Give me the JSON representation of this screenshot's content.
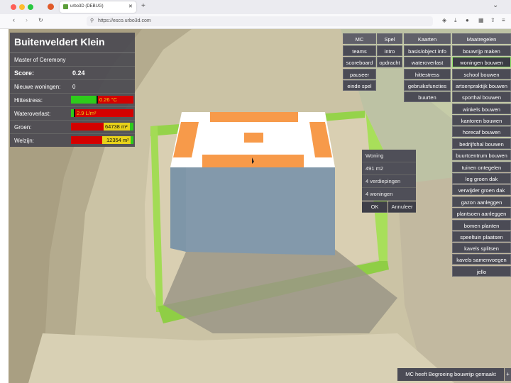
{
  "browser": {
    "tab_title": "urbo3D (DEBUG)",
    "url": "https://esco.urbo3d.com",
    "close_tab": "✕",
    "new_tab": "+",
    "chevron": "⌄"
  },
  "colors": {
    "panel": "#46464e",
    "accent_green": "#8fe36a",
    "bar_red": "#d40000",
    "bar_green": "#2ecc1a",
    "bar_yellow": "#e8d21a"
  },
  "info": {
    "title": "Buitenveldert Klein",
    "role": "Master of Ceremony",
    "score_label": "Score:",
    "score_value": "0.24",
    "homes_label": "Nieuwe woningen:",
    "homes_value": "0",
    "heat_label": "Hittestress:",
    "heat_value": "0.26 °C",
    "water_label": "Wateroverlast:",
    "water_value": "2.9 L/m²",
    "green_label": "Groen:",
    "green_value": "64738 m²",
    "wellbeing_label": "Welzijn:",
    "wellbeing_value": "12354 m²"
  },
  "menu": {
    "mc": {
      "header": "MC",
      "items": [
        "teams",
        "scoreboard",
        "pauseer",
        "einde spel"
      ]
    },
    "spel": {
      "header": "Spel",
      "items": [
        "intro",
        "opdracht"
      ]
    },
    "kaarten": {
      "header": "Kaarten",
      "items": [
        "basis/object info",
        "wateroverlast",
        "hittestress",
        "gebruiksfuncties",
        "buurten"
      ]
    },
    "maatregelen": {
      "header": "Maatregelen",
      "items": [
        "bouwrijp maken",
        "woningen bouwen",
        "school bouwen",
        "artsenpraktijk bouwen",
        "sporthal bouwen",
        "winkels bouwen",
        "kantoren bouwen",
        "horecaf bouwen",
        "bedrijfshal bouwen",
        "buurtcentrum bouwen",
        "tuinen ontegelen",
        "leg groen dak",
        "verwijder groen dak",
        "gazon aanleggen",
        "plantsoen aanleggen",
        "bomen planten",
        "speeltuin plaatsen",
        "kavels splitsen",
        "kavels samenvoegen",
        "jello"
      ],
      "active": "woningen bouwen"
    }
  },
  "dialog": {
    "title": "Woning",
    "area": "491 m2",
    "floors": "4 verdiepingen",
    "homes": "4 woningen",
    "ok": "OK",
    "cancel": "Annuleer"
  },
  "status": {
    "message": "MC heeft Begroeing bouwrijp gemaakt",
    "plus": "+"
  }
}
